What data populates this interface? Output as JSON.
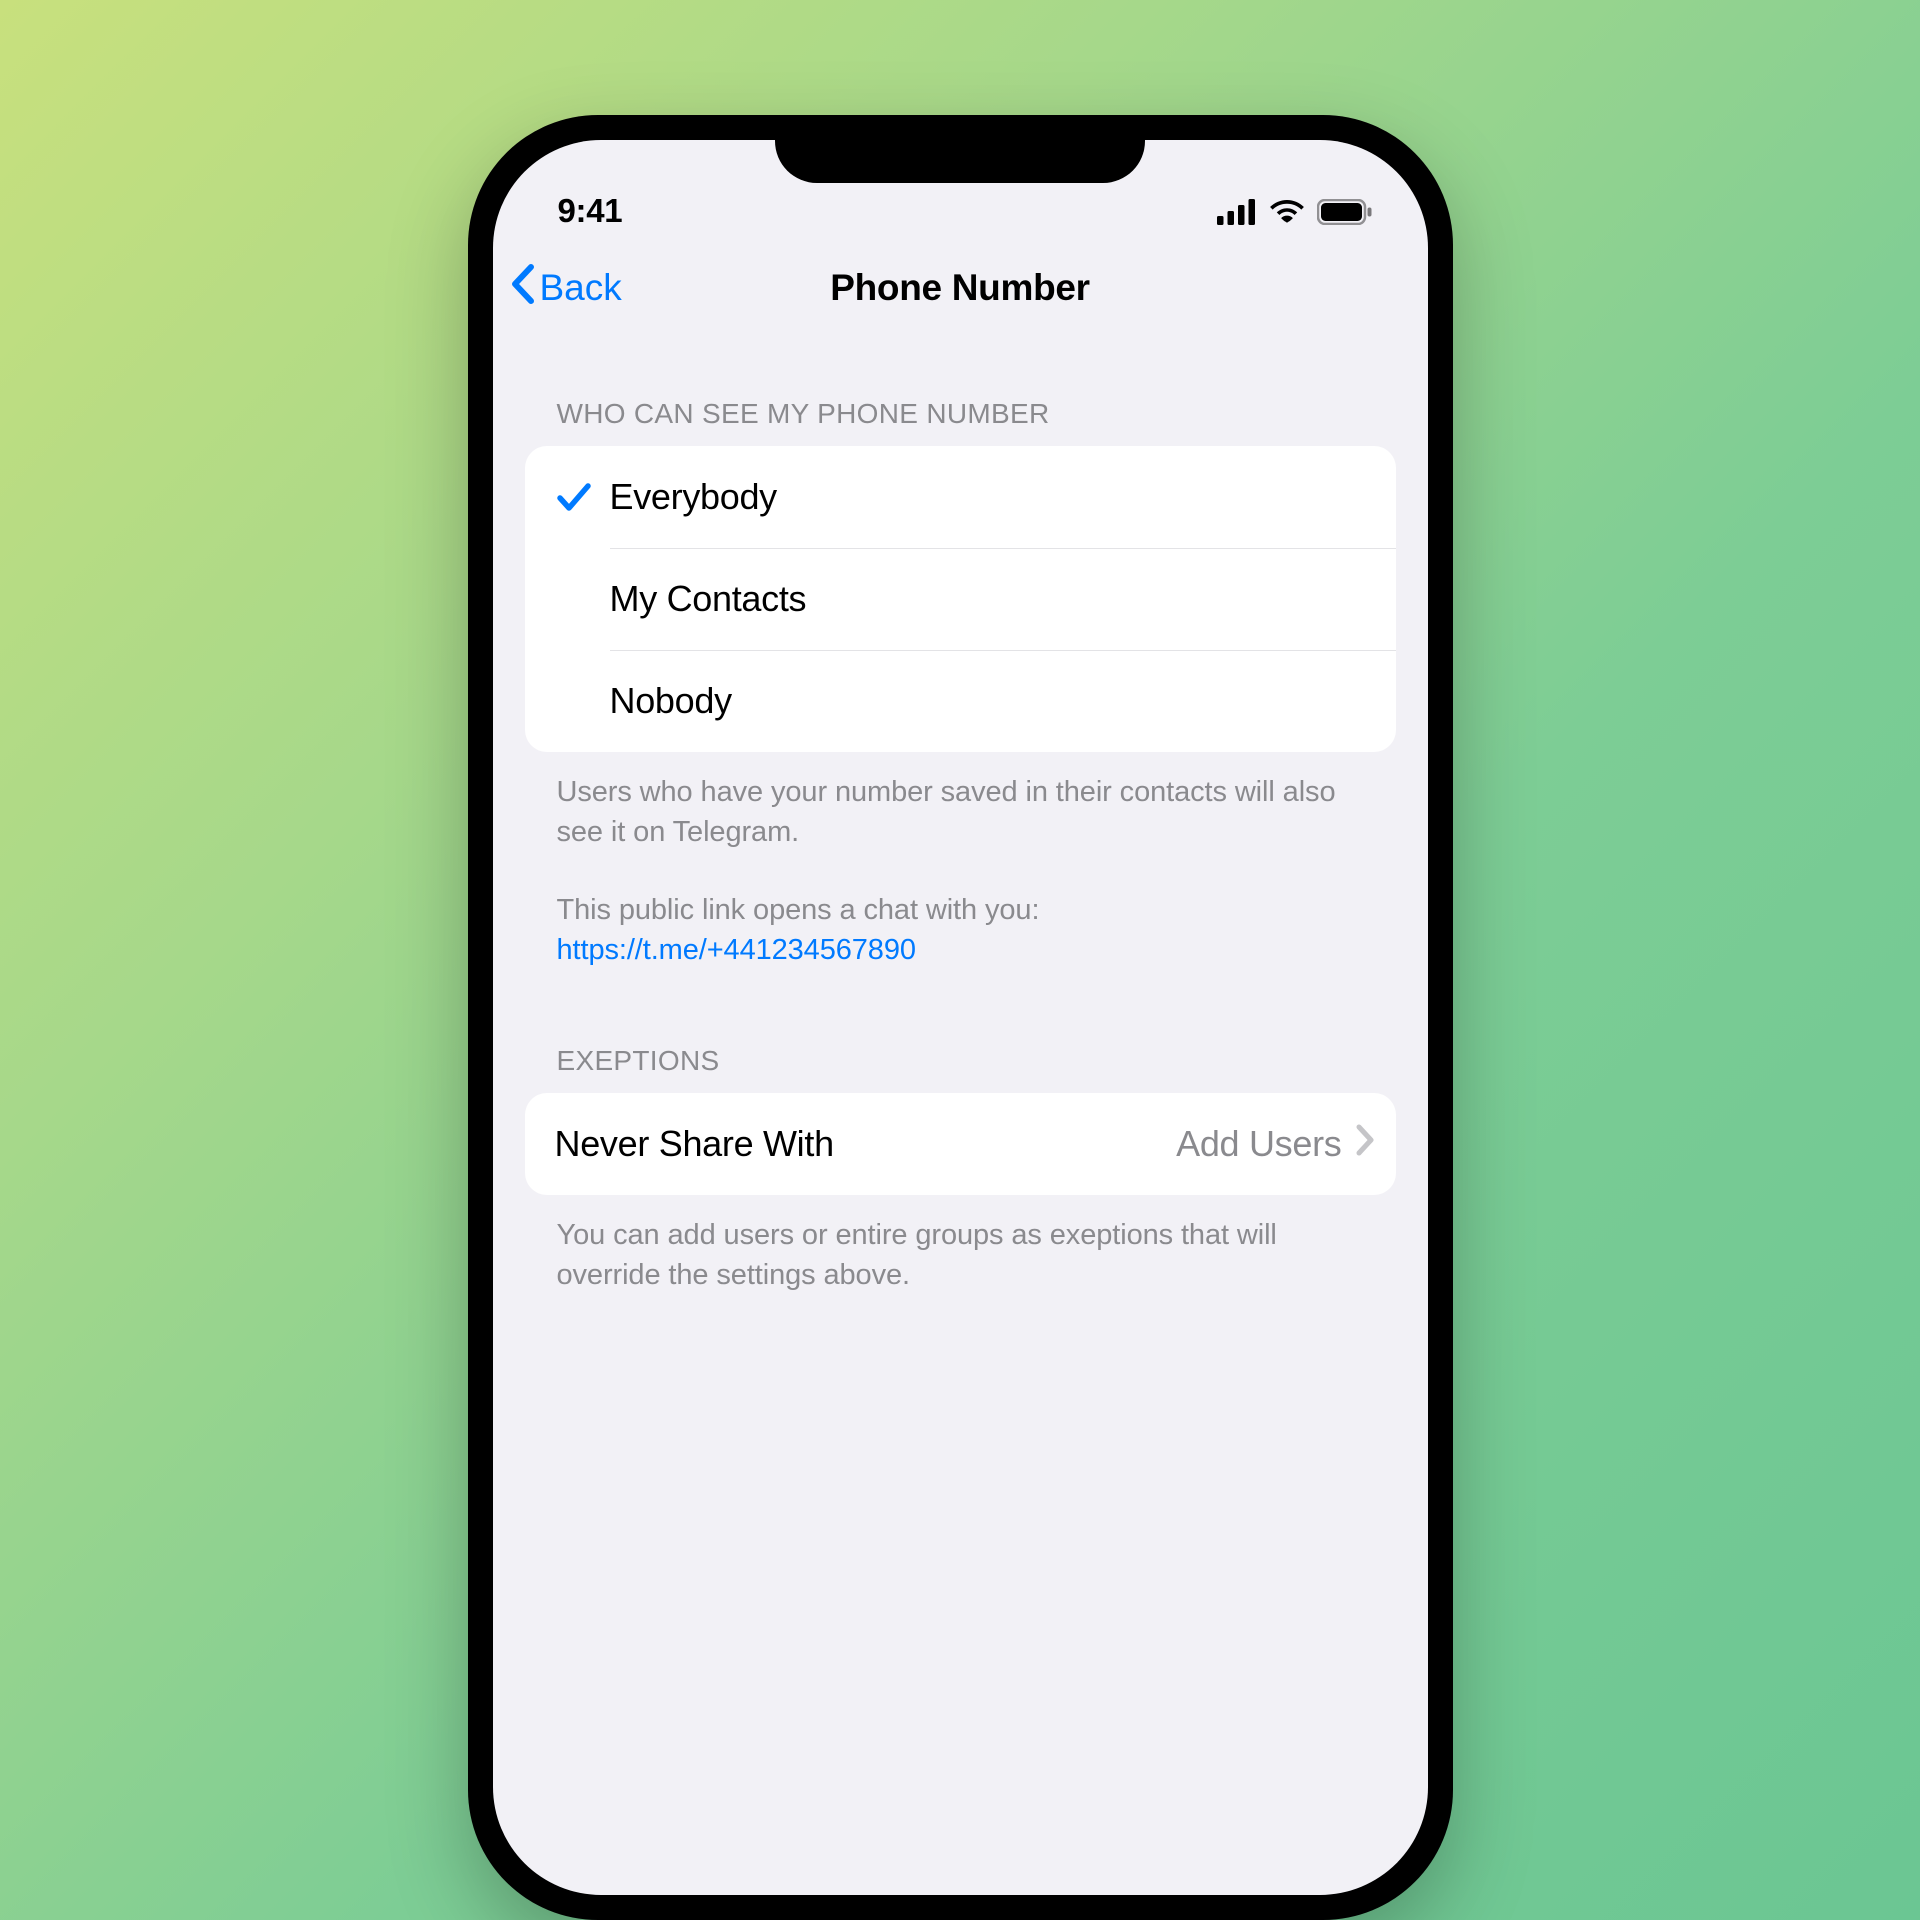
{
  "statusBar": {
    "time": "9:41"
  },
  "nav": {
    "back": "Back",
    "title": "Phone Number"
  },
  "visibility": {
    "header": "WHO CAN SEE MY PHONE NUMBER",
    "options": [
      {
        "label": "Everybody",
        "selected": true
      },
      {
        "label": "My Contacts",
        "selected": false
      },
      {
        "label": "Nobody",
        "selected": false
      }
    ],
    "footer1": "Users who have your number saved in their contacts will also see it on Telegram.",
    "footer2": "This public link opens a chat with you:",
    "link": "https://t.me/+441234567890"
  },
  "exceptions": {
    "header": "EXEPTIONS",
    "row": {
      "label": "Never Share With",
      "value": "Add Users"
    },
    "footer": "You can add users or entire groups as exeptions that will override the settings above."
  }
}
